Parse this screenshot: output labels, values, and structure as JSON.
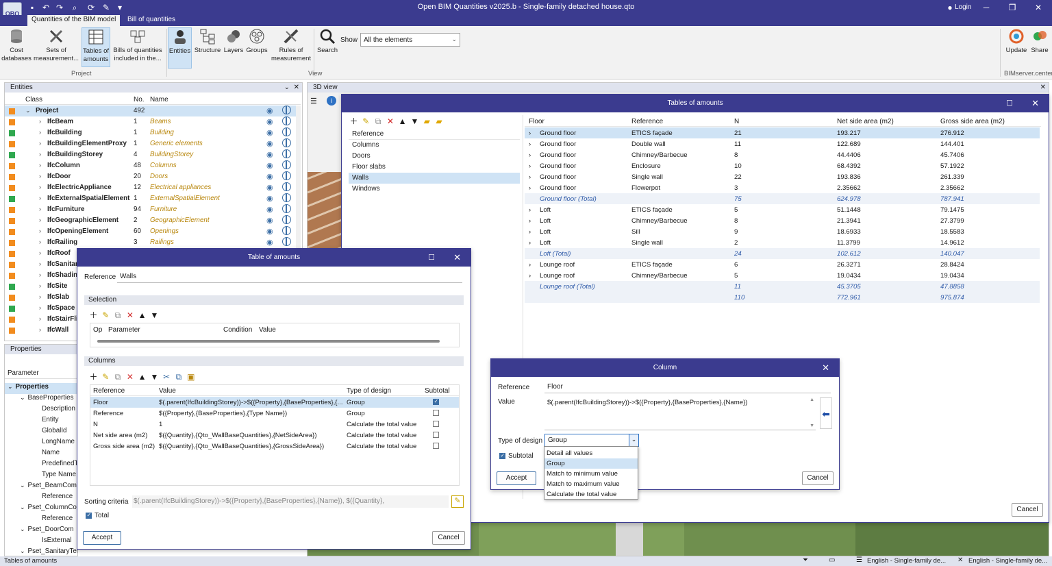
{
  "app": {
    "title": "Open BIM Quantities v2025.b - Single-family detached house.qto",
    "login": "Login",
    "logo_text": "OBQ"
  },
  "ribbon": {
    "tabs": [
      "Quantities of the BIM model",
      "Bill of quantities"
    ],
    "project_group": "Project",
    "view_group": "View",
    "bimserver_group": "BIMserver.center",
    "buttons": {
      "cost_databases": "Cost databases",
      "sets_of_measurement": "Sets of measurement...",
      "tables_of_amounts": "Tables of amounts",
      "bills_included": "Bills of quantities included in the...",
      "entities": "Entities",
      "structure": "Structure",
      "layers": "Layers",
      "groups": "Groups",
      "rules_of_measurement": "Rules of measurement",
      "search": "Search",
      "update": "Update",
      "share": "Share"
    },
    "show_label": "Show",
    "show_value": "All the elements"
  },
  "entities": {
    "title": "Entities",
    "col_class": "Class",
    "col_no": "No.",
    "col_name": "Name",
    "rows": [
      {
        "cls": "Project",
        "no": "492",
        "name": "",
        "color": "#f28c1e",
        "level": 0,
        "open": true
      },
      {
        "cls": "IfcBeam",
        "no": "1",
        "name": "Beams",
        "color": "#f28c1e",
        "level": 1
      },
      {
        "cls": "IfcBuilding",
        "no": "1",
        "name": "Building",
        "color": "#2fa84f",
        "level": 1
      },
      {
        "cls": "IfcBuildingElementProxy",
        "no": "1",
        "name": "Generic elements",
        "color": "#f28c1e",
        "level": 1
      },
      {
        "cls": "IfcBuildingStorey",
        "no": "4",
        "name": "BuildingStorey",
        "color": "#2fa84f",
        "level": 1
      },
      {
        "cls": "IfcColumn",
        "no": "48",
        "name": "Columns",
        "color": "#f28c1e",
        "level": 1
      },
      {
        "cls": "IfcDoor",
        "no": "20",
        "name": "Doors",
        "color": "#f28c1e",
        "level": 1
      },
      {
        "cls": "IfcElectricAppliance",
        "no": "12",
        "name": "Electrical appliances",
        "color": "#f28c1e",
        "level": 1
      },
      {
        "cls": "IfcExternalSpatialElement",
        "no": "1",
        "name": "ExternalSpatialElement",
        "color": "#2fa84f",
        "level": 1
      },
      {
        "cls": "IfcFurniture",
        "no": "94",
        "name": "Furniture",
        "color": "#f28c1e",
        "level": 1
      },
      {
        "cls": "IfcGeographicElement",
        "no": "2",
        "name": "GeographicElement",
        "color": "#f28c1e",
        "level": 1
      },
      {
        "cls": "IfcOpeningElement",
        "no": "60",
        "name": "Openings",
        "color": "#f28c1e",
        "level": 1
      },
      {
        "cls": "IfcRailing",
        "no": "3",
        "name": "Railings",
        "color": "#f28c1e",
        "level": 1
      },
      {
        "cls": "IfcRoof",
        "no": "",
        "name": "",
        "color": "#f28c1e",
        "level": 1
      },
      {
        "cls": "IfcSanitar",
        "no": "",
        "name": "",
        "color": "#f28c1e",
        "level": 1
      },
      {
        "cls": "IfcShadin",
        "no": "",
        "name": "",
        "color": "#f28c1e",
        "level": 1
      },
      {
        "cls": "IfcSite",
        "no": "",
        "name": "",
        "color": "#2fa84f",
        "level": 1
      },
      {
        "cls": "IfcSlab",
        "no": "",
        "name": "",
        "color": "#f28c1e",
        "level": 1
      },
      {
        "cls": "IfcSpace",
        "no": "",
        "name": "",
        "color": "#2fa84f",
        "level": 1
      },
      {
        "cls": "IfcStairFli",
        "no": "",
        "name": "",
        "color": "#f28c1e",
        "level": 1
      },
      {
        "cls": "IfcWall",
        "no": "",
        "name": "",
        "color": "#f28c1e",
        "level": 1
      }
    ]
  },
  "properties": {
    "title": "Properties",
    "col_parameter": "Parameter",
    "rows": [
      {
        "t": "Properties",
        "lvl": 0,
        "bold": true,
        "chev": true
      },
      {
        "t": "BaseProperties",
        "lvl": 1,
        "chev": true
      },
      {
        "t": "Description",
        "lvl": 2
      },
      {
        "t": "Entity",
        "lvl": 2
      },
      {
        "t": "GlobalId",
        "lvl": 2
      },
      {
        "t": "LongName",
        "lvl": 2
      },
      {
        "t": "Name",
        "lvl": 2
      },
      {
        "t": "PredefinedT",
        "lvl": 2
      },
      {
        "t": "Type Name",
        "lvl": 2
      },
      {
        "t": "Pset_BeamCom",
        "lvl": 1,
        "chev": true
      },
      {
        "t": "Reference",
        "lvl": 2
      },
      {
        "t": "Pset_ColumnCo",
        "lvl": 1,
        "chev": true
      },
      {
        "t": "Reference",
        "lvl": 2
      },
      {
        "t": "Pset_DoorCom",
        "lvl": 1,
        "chev": true
      },
      {
        "t": "IsExternal",
        "lvl": 2
      },
      {
        "t": "Pset_SanitaryTerminalTypeBath",
        "lvl": 1,
        "chev": true
      }
    ]
  },
  "view3d": {
    "title": "3D view"
  },
  "tables_dialog": {
    "title": "Tables of amounts",
    "list": [
      "Reference",
      "Columns",
      "Doors",
      "Floor slabs",
      "Walls",
      "Windows"
    ],
    "selected_index": 4,
    "headers": [
      "Floor",
      "Reference",
      "N",
      "Net side area (m2)",
      "Gross side area (m2)"
    ],
    "rows": [
      {
        "floor": "Ground floor",
        "ref": "ETICS façade",
        "n": "21",
        "net": "193.217",
        "gross": "276.912",
        "sel": true
      },
      {
        "floor": "Ground floor",
        "ref": "Double wall",
        "n": "11",
        "net": "122.689",
        "gross": "144.401"
      },
      {
        "floor": "Ground floor",
        "ref": "Chimney/Barbecue",
        "n": "8",
        "net": "44.4406",
        "gross": "45.7406"
      },
      {
        "floor": "Ground floor",
        "ref": "Enclosure",
        "n": "10",
        "net": "68.4392",
        "gross": "57.1922"
      },
      {
        "floor": "Ground floor",
        "ref": "Single wall",
        "n": "22",
        "net": "193.836",
        "gross": "261.339"
      },
      {
        "floor": "Ground floor",
        "ref": "Flowerpot",
        "n": "3",
        "net": "2.35662",
        "gross": "2.35662"
      },
      {
        "floor": "Ground floor (Total)",
        "ref": "",
        "n": "75",
        "net": "624.978",
        "gross": "787.941",
        "total": true
      },
      {
        "floor": "Loft",
        "ref": "ETICS façade",
        "n": "5",
        "net": "51.1448",
        "gross": "79.1475"
      },
      {
        "floor": "Loft",
        "ref": "Chimney/Barbecue",
        "n": "8",
        "net": "21.3941",
        "gross": "27.3799"
      },
      {
        "floor": "Loft",
        "ref": "Sill",
        "n": "9",
        "net": "18.6933",
        "gross": "18.5583"
      },
      {
        "floor": "Loft",
        "ref": "Single wall",
        "n": "2",
        "net": "11.3799",
        "gross": "14.9612"
      },
      {
        "floor": "Loft (Total)",
        "ref": "",
        "n": "24",
        "net": "102.612",
        "gross": "140.047",
        "total": true
      },
      {
        "floor": "Lounge roof",
        "ref": "ETICS façade",
        "n": "6",
        "net": "26.3271",
        "gross": "28.8424"
      },
      {
        "floor": "Lounge roof",
        "ref": "Chimney/Barbecue",
        "n": "5",
        "net": "19.0434",
        "gross": "19.0434"
      },
      {
        "floor": "Lounge roof (Total)",
        "ref": "",
        "n": "11",
        "net": "45.3705",
        "gross": "47.8858",
        "total": true
      },
      {
        "floor": "",
        "ref": "",
        "n": "110",
        "net": "772.961",
        "gross": "975.874",
        "total": true
      }
    ],
    "cancel": "Cancel"
  },
  "table_dialog": {
    "title": "Table of amounts",
    "reference_label": "Reference",
    "reference_value": "Walls",
    "selection_label": "Selection",
    "sel_headers": [
      "Op",
      "Parameter",
      "Condition",
      "Value"
    ],
    "columns_label": "Columns",
    "col_headers": [
      "Reference",
      "Value",
      "Type of design",
      "Subtotal"
    ],
    "columns": [
      {
        "ref": "Floor",
        "val": "$(.parent(IfcBuildingStorey))->$({Property},{BaseProperties},{...",
        "type": "Group",
        "sub": true,
        "sel": true
      },
      {
        "ref": "Reference",
        "val": "$({Property},{BaseProperties},{Type Name})",
        "type": "Group",
        "sub": false
      },
      {
        "ref": "N",
        "val": "1",
        "type": "Calculate the total value",
        "sub": false
      },
      {
        "ref": "Net side area (m2)",
        "val": "$({Quantity},{Qto_WallBaseQuantities},{NetSideArea})",
        "type": "Calculate the total value",
        "sub": false
      },
      {
        "ref": "Gross side area (m2)",
        "val": "$({Quantity},{Qto_WallBaseQuantities},{GrossSideArea})",
        "type": "Calculate the total value",
        "sub": false
      }
    ],
    "sorting_label": "Sorting criteria",
    "sorting_value": "$(.parent(IfcBuildingStorey))->$({Property},{BaseProperties},{Name}), $({Quantity},",
    "total_label": "Total",
    "accept": "Accept",
    "cancel": "Cancel"
  },
  "column_dialog": {
    "title": "Column",
    "reference_label": "Reference",
    "reference_value": "Floor",
    "value_label": "Value",
    "value_text": "$(.parent(IfcBuildingStorey))->$({Property},{BaseProperties},{Name})",
    "type_label": "Type of design",
    "type_value": "Group",
    "subtotal_label": "Subtotal",
    "options": [
      "Detail all values",
      "Group",
      "Match to minimum value",
      "Match to maximum value",
      "Calculate the total value"
    ],
    "selected_option": 1,
    "accept": "Accept",
    "cancel": "Cancel"
  },
  "status": {
    "left": "Tables of amounts",
    "lang1": "English - Single-family de...",
    "lang2": "English - Single-family de..."
  }
}
